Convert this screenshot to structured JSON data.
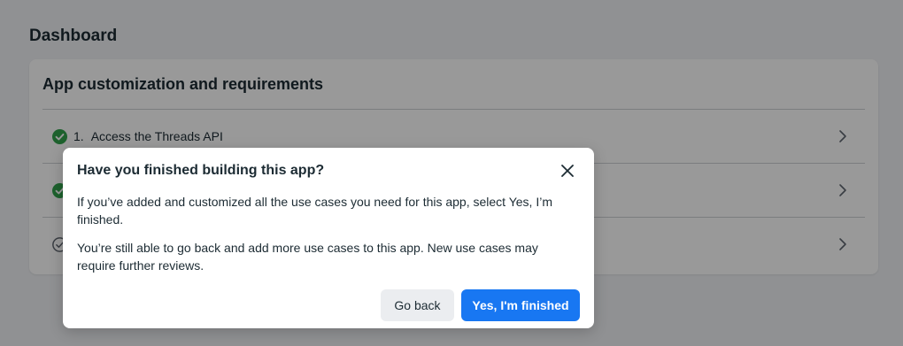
{
  "page": {
    "title": "Dashboard"
  },
  "card": {
    "title": "App customization and requirements",
    "items": [
      {
        "number": "1.",
        "label": "Access the Threads API",
        "status": "complete",
        "status_icon": "check-circle-filled-icon"
      },
      {
        "number": "",
        "label": "",
        "status": "complete",
        "status_icon": "check-circle-filled-icon"
      },
      {
        "number": "",
        "label": "",
        "status": "pending",
        "status_icon": "check-circle-outline-icon"
      }
    ]
  },
  "modal": {
    "title": "Have you finished building this app?",
    "paragraph1": "If you’ve added and customized all the use cases you need for this app, select Yes, I’m finished.",
    "paragraph2": "You’re still able to go back and add more use cases to this app. New use cases may require further reviews.",
    "secondary_button": "Go back",
    "primary_button": "Yes, I'm finished"
  },
  "colors": {
    "accent": "#1877f2",
    "success": "#31a24c",
    "overlay": "rgba(0,0,0,0.4)"
  }
}
